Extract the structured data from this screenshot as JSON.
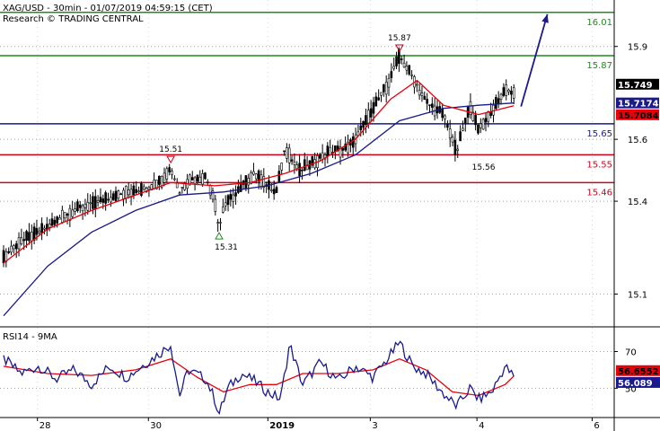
{
  "header": {
    "title_line": "XAG/USD - 30min - 01/07/2019 04:59:15 (CET)",
    "subtitle_line": "Research © TRADING CENTRAL"
  },
  "colors": {
    "candle": "#000000",
    "ma_fast": "#e8000a",
    "ma_slow": "#1a1a8c",
    "resistance": "#1e8c1e",
    "pivot": "#1a1a8c",
    "support": "#d0021b",
    "arrow": "#1a1a8c",
    "rsi_line": "#1a1a8c",
    "rsi_ma": "#e8000a"
  },
  "chart_data": [
    {
      "type": "candlestick",
      "instrument": "XAG/USD",
      "timeframe": "30min",
      "ylim": [
        15.0,
        16.05
      ],
      "y_ticks": [
        15.1,
        15.4,
        15.6,
        15.9
      ],
      "x_ticks": [
        "28",
        "30",
        "2019",
        "3",
        "4",
        "6"
      ],
      "price_path": [
        {
          "x": 0,
          "y": 15.22
        },
        {
          "x": 4,
          "y": 15.27
        },
        {
          "x": 8,
          "y": 15.3
        },
        {
          "x": 12,
          "y": 15.34
        },
        {
          "x": 16,
          "y": 15.37
        },
        {
          "x": 20,
          "y": 15.39
        },
        {
          "x": 24,
          "y": 15.41
        },
        {
          "x": 28,
          "y": 15.43
        },
        {
          "x": 32,
          "y": 15.44
        },
        {
          "x": 36,
          "y": 15.47
        },
        {
          "x": 38,
          "y": 15.51
        },
        {
          "x": 40,
          "y": 15.43
        },
        {
          "x": 42,
          "y": 15.47
        },
        {
          "x": 46,
          "y": 15.48
        },
        {
          "x": 48,
          "y": 15.4
        },
        {
          "x": 49,
          "y": 15.31
        },
        {
          "x": 50,
          "y": 15.38
        },
        {
          "x": 53,
          "y": 15.43
        },
        {
          "x": 57,
          "y": 15.49
        },
        {
          "x": 60,
          "y": 15.45
        },
        {
          "x": 62,
          "y": 15.43
        },
        {
          "x": 64,
          "y": 15.57
        },
        {
          "x": 67,
          "y": 15.5
        },
        {
          "x": 70,
          "y": 15.52
        },
        {
          "x": 74,
          "y": 15.56
        },
        {
          "x": 78,
          "y": 15.57
        },
        {
          "x": 80,
          "y": 15.6
        },
        {
          "x": 84,
          "y": 15.7
        },
        {
          "x": 87,
          "y": 15.77
        },
        {
          "x": 90,
          "y": 15.87
        },
        {
          "x": 93,
          "y": 15.8
        },
        {
          "x": 96,
          "y": 15.72
        },
        {
          "x": 100,
          "y": 15.68
        },
        {
          "x": 103,
          "y": 15.56
        },
        {
          "x": 106,
          "y": 15.71
        },
        {
          "x": 108,
          "y": 15.63
        },
        {
          "x": 111,
          "y": 15.69
        },
        {
          "x": 114,
          "y": 15.76
        },
        {
          "x": 116,
          "y": 15.749
        }
      ],
      "ma_fast_path": [
        {
          "x": 0,
          "y": 15.2
        },
        {
          "x": 10,
          "y": 15.31
        },
        {
          "x": 20,
          "y": 15.37
        },
        {
          "x": 30,
          "y": 15.42
        },
        {
          "x": 38,
          "y": 15.46
        },
        {
          "x": 48,
          "y": 15.45
        },
        {
          "x": 56,
          "y": 15.46
        },
        {
          "x": 64,
          "y": 15.49
        },
        {
          "x": 72,
          "y": 15.53
        },
        {
          "x": 80,
          "y": 15.6
        },
        {
          "x": 88,
          "y": 15.73
        },
        {
          "x": 94,
          "y": 15.79
        },
        {
          "x": 100,
          "y": 15.71
        },
        {
          "x": 108,
          "y": 15.68
        },
        {
          "x": 116,
          "y": 15.7084
        }
      ],
      "ma_slow_path": [
        {
          "x": 0,
          "y": 15.03
        },
        {
          "x": 10,
          "y": 15.19
        },
        {
          "x": 20,
          "y": 15.3
        },
        {
          "x": 30,
          "y": 15.37
        },
        {
          "x": 40,
          "y": 15.42
        },
        {
          "x": 50,
          "y": 15.43
        },
        {
          "x": 60,
          "y": 15.45
        },
        {
          "x": 70,
          "y": 15.49
        },
        {
          "x": 80,
          "y": 15.55
        },
        {
          "x": 90,
          "y": 15.66
        },
        {
          "x": 100,
          "y": 15.7
        },
        {
          "x": 108,
          "y": 15.71
        },
        {
          "x": 116,
          "y": 15.7174
        }
      ],
      "levels": [
        {
          "label": "16.01",
          "value": 16.01,
          "kind": "resistance"
        },
        {
          "label": "15.87",
          "value": 15.87,
          "kind": "resistance"
        },
        {
          "label": "15.65",
          "value": 15.65,
          "kind": "pivot"
        },
        {
          "label": "15.55",
          "value": 15.55,
          "kind": "support"
        },
        {
          "label": "15.46",
          "value": 15.46,
          "kind": "support"
        }
      ],
      "annotations": [
        {
          "text": "15.87",
          "x": 90,
          "y": 15.87,
          "marker": "down",
          "side": "above"
        },
        {
          "text": "15.51",
          "x": 38,
          "y": 15.51,
          "marker": "down",
          "side": "above"
        },
        {
          "text": "15.31",
          "x": 49,
          "y": 15.31,
          "marker": "up",
          "side": "below"
        },
        {
          "text": "15.56",
          "x": 103,
          "y": 15.56,
          "marker": "none",
          "side": "below"
        }
      ],
      "target_arrow": {
        "from": {
          "x": 116,
          "y": 15.7
        },
        "to": {
          "x": 122,
          "y": 16.01
        }
      },
      "price_badges": [
        {
          "text": "15.749",
          "value": 15.749,
          "bg": "#000000",
          "fg": "#ffffff"
        },
        {
          "text": "15.7174",
          "value": 15.7174,
          "bg": "#1a1a8c",
          "fg": "#ffffff"
        },
        {
          "text": "15.7084",
          "value": 15.7084,
          "bg": "#e8000a",
          "fg": "#000000"
        }
      ]
    },
    {
      "type": "line",
      "title": "RSI14 - 9MA",
      "ylim": [
        35,
        82
      ],
      "y_ticks": [
        50,
        70
      ],
      "rsi_path": [
        {
          "x": 0,
          "y": 66
        },
        {
          "x": 4,
          "y": 58
        },
        {
          "x": 8,
          "y": 62
        },
        {
          "x": 12,
          "y": 55
        },
        {
          "x": 16,
          "y": 60
        },
        {
          "x": 20,
          "y": 52
        },
        {
          "x": 24,
          "y": 62
        },
        {
          "x": 28,
          "y": 56
        },
        {
          "x": 32,
          "y": 63
        },
        {
          "x": 36,
          "y": 70
        },
        {
          "x": 38,
          "y": 74
        },
        {
          "x": 40,
          "y": 46
        },
        {
          "x": 42,
          "y": 60
        },
        {
          "x": 46,
          "y": 55
        },
        {
          "x": 48,
          "y": 44
        },
        {
          "x": 49,
          "y": 36
        },
        {
          "x": 51,
          "y": 50
        },
        {
          "x": 54,
          "y": 58
        },
        {
          "x": 57,
          "y": 54
        },
        {
          "x": 60,
          "y": 48
        },
        {
          "x": 63,
          "y": 44
        },
        {
          "x": 65,
          "y": 74
        },
        {
          "x": 68,
          "y": 52
        },
        {
          "x": 72,
          "y": 64
        },
        {
          "x": 76,
          "y": 54
        },
        {
          "x": 80,
          "y": 62
        },
        {
          "x": 84,
          "y": 56
        },
        {
          "x": 87,
          "y": 65
        },
        {
          "x": 90,
          "y": 75
        },
        {
          "x": 93,
          "y": 62
        },
        {
          "x": 96,
          "y": 58
        },
        {
          "x": 100,
          "y": 47
        },
        {
          "x": 103,
          "y": 40
        },
        {
          "x": 106,
          "y": 50
        },
        {
          "x": 108,
          "y": 44
        },
        {
          "x": 111,
          "y": 48
        },
        {
          "x": 114,
          "y": 62
        },
        {
          "x": 116,
          "y": 56.089
        }
      ],
      "ma_path": [
        {
          "x": 0,
          "y": 62
        },
        {
          "x": 10,
          "y": 58
        },
        {
          "x": 20,
          "y": 57
        },
        {
          "x": 30,
          "y": 60
        },
        {
          "x": 38,
          "y": 66
        },
        {
          "x": 44,
          "y": 56
        },
        {
          "x": 50,
          "y": 48
        },
        {
          "x": 56,
          "y": 52
        },
        {
          "x": 62,
          "y": 52
        },
        {
          "x": 68,
          "y": 58
        },
        {
          "x": 76,
          "y": 58
        },
        {
          "x": 84,
          "y": 60
        },
        {
          "x": 90,
          "y": 66
        },
        {
          "x": 96,
          "y": 60
        },
        {
          "x": 102,
          "y": 48
        },
        {
          "x": 108,
          "y": 46
        },
        {
          "x": 114,
          "y": 52
        },
        {
          "x": 116,
          "y": 56.6552
        }
      ],
      "badges": [
        {
          "text": "56.6552",
          "value": 56.6552,
          "bg": "#e8000a",
          "fg": "#000000"
        },
        {
          "text": "56.089",
          "value": 56.089,
          "bg": "#1a1a8c",
          "fg": "#ffffff"
        }
      ]
    }
  ]
}
